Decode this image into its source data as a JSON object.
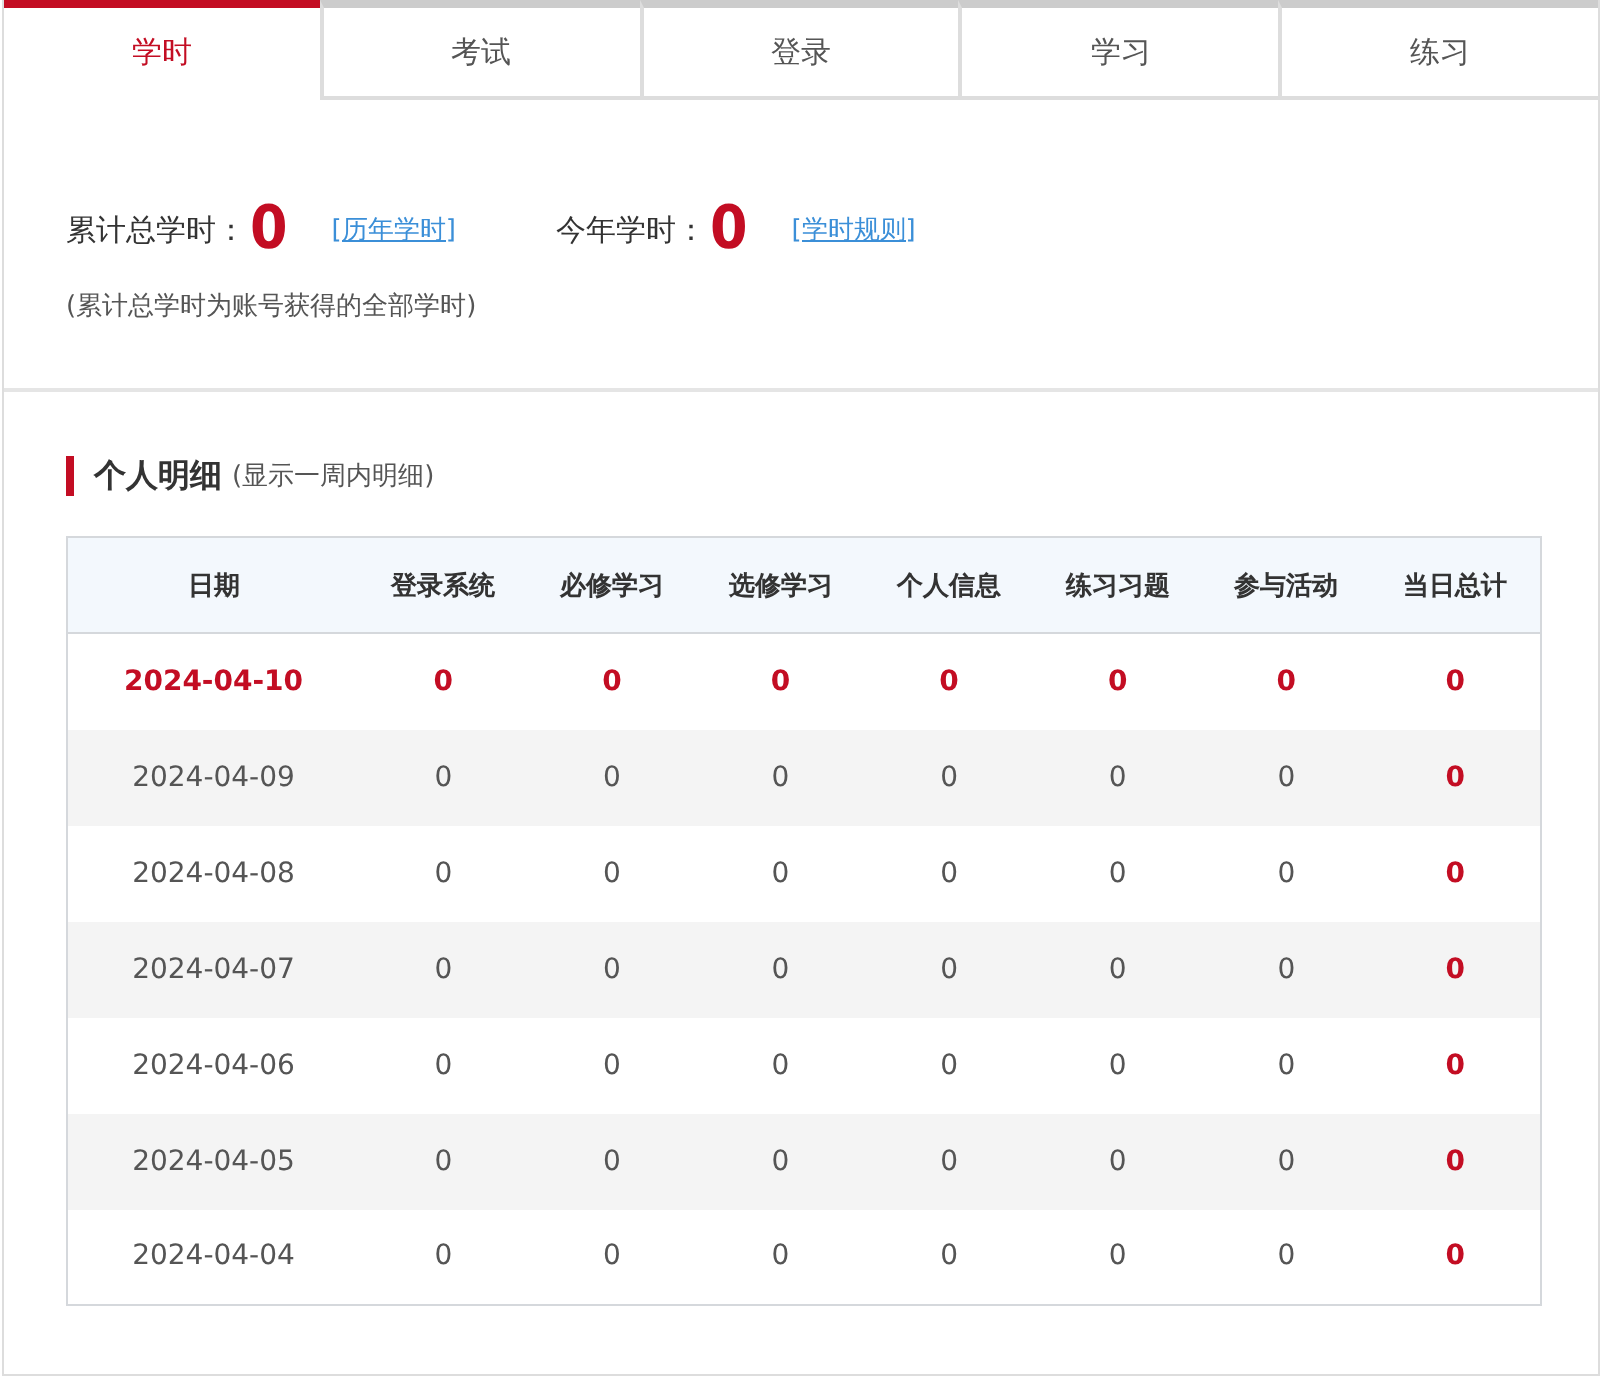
{
  "tabs": [
    {
      "label": "学时",
      "selected": true
    },
    {
      "label": "考试",
      "selected": false
    },
    {
      "label": "登录",
      "selected": false
    },
    {
      "label": "学习",
      "selected": false
    },
    {
      "label": "练习",
      "selected": false
    }
  ],
  "summary": {
    "items": [
      {
        "label": "累计总学时：",
        "value": "0",
        "link": "[历年学时]"
      },
      {
        "label": "今年学时：",
        "value": "0",
        "link": "[学时规则]"
      }
    ],
    "note": "(累计总学时为账号获得的全部学时)"
  },
  "detail": {
    "title": "个人明细",
    "subtitle": "(显示一周内明细)",
    "table": {
      "columns": [
        "日期",
        "登录系统",
        "必修学习",
        "选修学习",
        "个人信息",
        "练习习题",
        "参与活动",
        "当日总计"
      ],
      "rows": [
        {
          "highlight": true,
          "cells": [
            "2024-04-10",
            "0",
            "0",
            "0",
            "0",
            "0",
            "0",
            "0"
          ]
        },
        {
          "highlight": false,
          "cells": [
            "2024-04-09",
            "0",
            "0",
            "0",
            "0",
            "0",
            "0",
            "0"
          ]
        },
        {
          "highlight": false,
          "cells": [
            "2024-04-08",
            "0",
            "0",
            "0",
            "0",
            "0",
            "0",
            "0"
          ]
        },
        {
          "highlight": false,
          "cells": [
            "2024-04-07",
            "0",
            "0",
            "0",
            "0",
            "0",
            "0",
            "0"
          ]
        },
        {
          "highlight": false,
          "cells": [
            "2024-04-06",
            "0",
            "0",
            "0",
            "0",
            "0",
            "0",
            "0"
          ]
        },
        {
          "highlight": false,
          "cells": [
            "2024-04-05",
            "0",
            "0",
            "0",
            "0",
            "0",
            "0",
            "0"
          ]
        },
        {
          "highlight": false,
          "cells": [
            "2024-04-04",
            "0",
            "0",
            "0",
            "0",
            "0",
            "0",
            "0"
          ]
        }
      ]
    }
  }
}
